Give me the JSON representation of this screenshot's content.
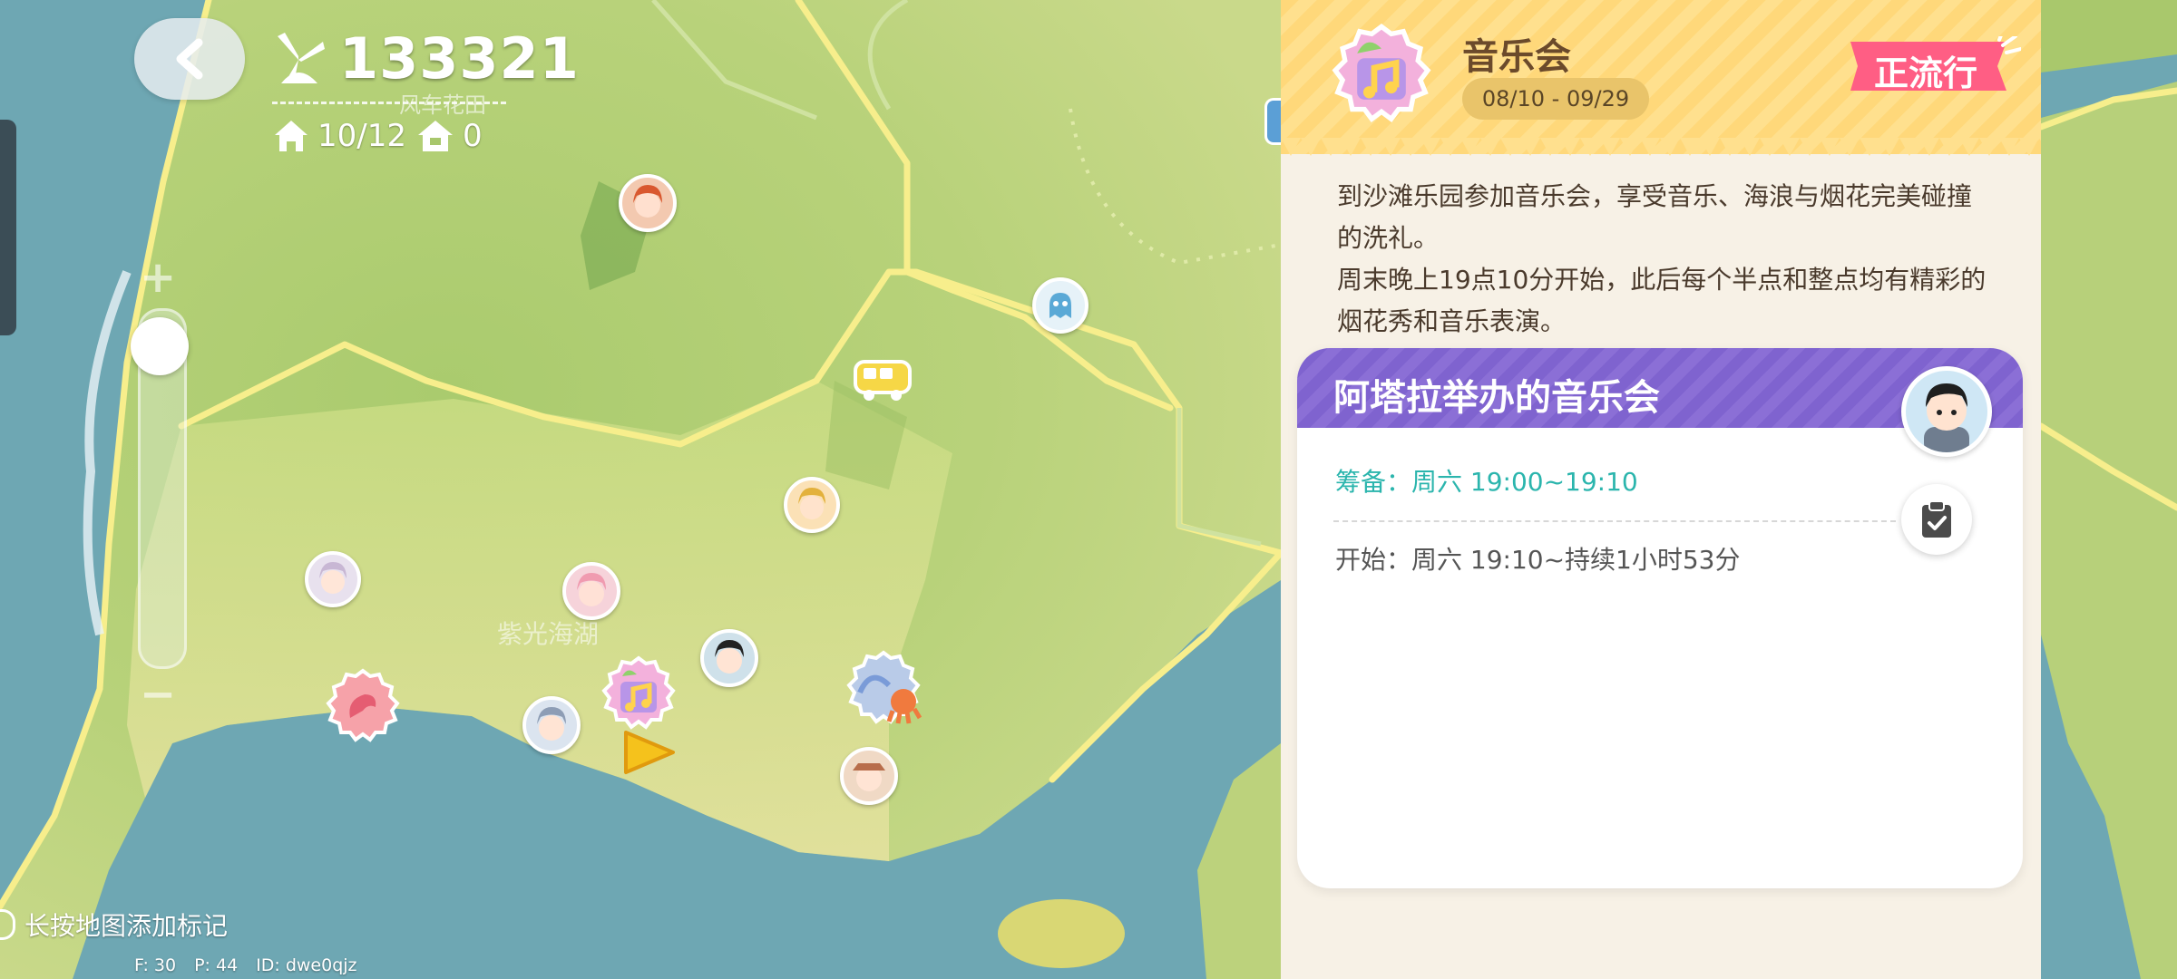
{
  "hud": {
    "score": "133321",
    "area_name": "风车花田",
    "houses": "10/12",
    "homes": "0"
  },
  "map": {
    "labels": {
      "zone": "紫光海湖"
    },
    "hint": "长按地图添加标记",
    "debug": {
      "f": "F: 30",
      "p": "P: 44",
      "id": "ID: dwe0qjz"
    }
  },
  "event": {
    "title": "音乐会",
    "dates": "08/10 - 09/29",
    "badge": "正流行",
    "description": "到沙滩乐园参加音乐会，享受音乐、海浪与烟花完美碰撞的洗礼。\n周末晚上19点10分开始，此后每个半点和整点均有精彩的烟花秀和音乐表演。",
    "card": {
      "title": "阿塔拉举办的音乐会",
      "prep": "筹备：周六 19:00~19:10",
      "start": "开始：周六 19:10~持续1小时53分"
    }
  },
  "colors": {
    "accent_purple": "#8b6fd6",
    "badge_pink": "#ff5e84",
    "prep_teal": "#2bb5ad",
    "road_yellow": "#f8ec8a"
  },
  "icons": [
    "back-arrow-icon",
    "windmill-icon",
    "house-icon",
    "home-icon",
    "bus-icon",
    "clipboard-icon",
    "play-arrow-icon"
  ]
}
